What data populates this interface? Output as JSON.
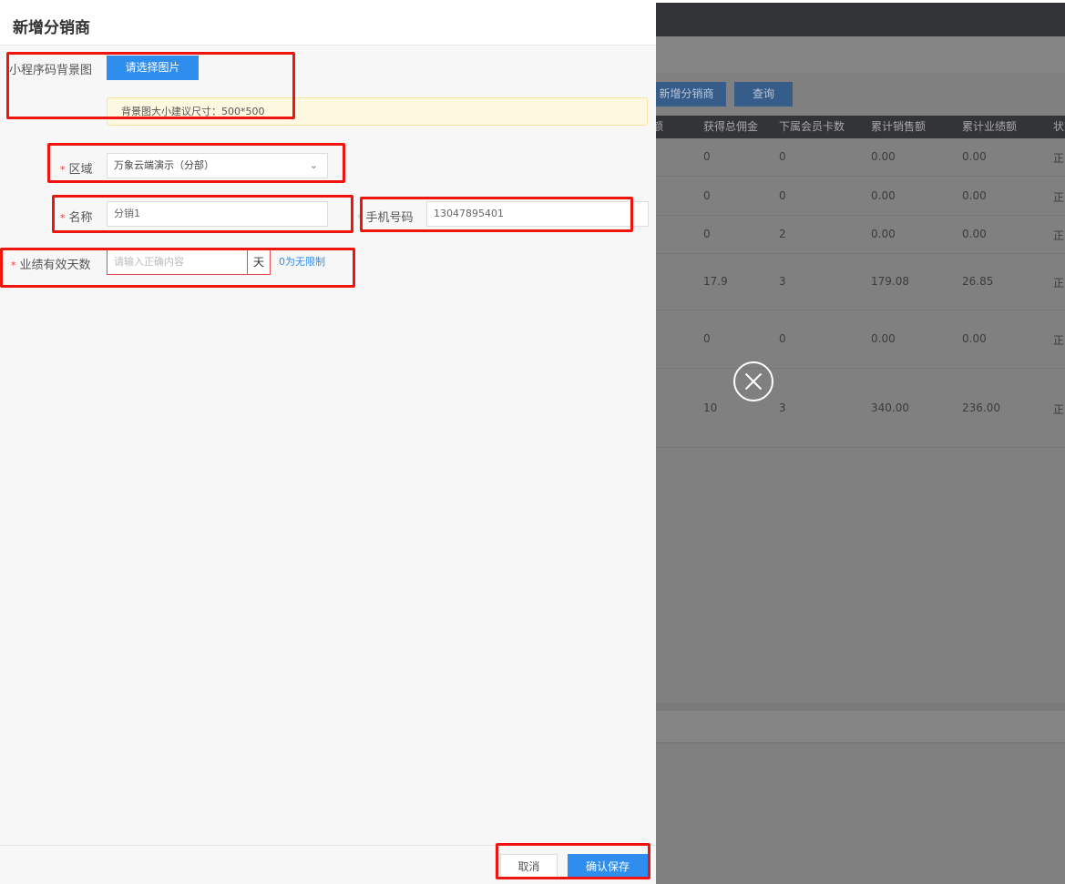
{
  "background": {
    "buttons": {
      "add_distributor": "新增分销商",
      "query": "查询"
    },
    "table": {
      "headers": [
        "余额",
        "获得总佣金",
        "下属会员卡数",
        "累计销售额",
        "累计业绩额",
        "状态"
      ],
      "rows": [
        [
          "0",
          "0",
          "0.00",
          "0.00",
          "正常"
        ],
        [
          "0",
          "0",
          "0.00",
          "0.00",
          "正常"
        ],
        [
          "0",
          "2",
          "0.00",
          "0.00",
          "正常"
        ],
        [
          "17.9",
          "3",
          "179.08",
          "26.85",
          "正常"
        ],
        [
          "0",
          "0",
          "0.00",
          "0.00",
          "正常"
        ],
        [
          "10",
          "3",
          "340.00",
          "236.00",
          "正常"
        ]
      ]
    }
  },
  "drawer": {
    "title": "新增分销商",
    "bg_image": {
      "label": "小程序码背景图",
      "button": "请选择图片",
      "tip": "背景图大小建议尺寸：500*500"
    },
    "region": {
      "label": "区域",
      "value": "万象云端演示（分部）"
    },
    "name": {
      "label": "名称",
      "value": "分销1"
    },
    "phone": {
      "label": "手机号码",
      "value": "13047895401"
    },
    "valid_days": {
      "label": "业绩有效天数",
      "placeholder": "请输入正确内容",
      "unit": "天",
      "hint": "0为无限制"
    },
    "footer": {
      "cancel": "取消",
      "save": "确认保存"
    }
  },
  "colors": {
    "primary": "#2e8ded",
    "required": "#ee3333",
    "highlight": "#f0140f",
    "tip_bg": "#fff8e1"
  }
}
